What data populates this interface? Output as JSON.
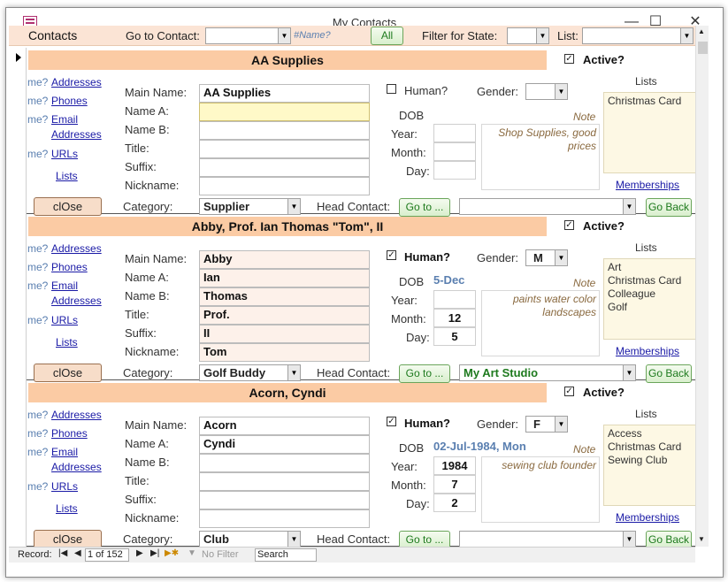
{
  "window": {
    "title": "My Contacts",
    "minimize_glyph": "—",
    "maximize_glyph": "☐",
    "close_glyph": "✕"
  },
  "header": {
    "title": "Contacts",
    "goto_label": "Go to Contact:",
    "goto_value": "",
    "name_hint": "#Name?",
    "all_label": "All",
    "filter_label": "Filter for State:",
    "list_label": "List:"
  },
  "records": [
    {
      "title": "AA Supplies",
      "active_label": "Active?",
      "active": "✓",
      "human_label": "Human?",
      "human": "",
      "gender_label": "Gender:",
      "gender": "",
      "links": {
        "me1": "me?",
        "addresses": "Addresses",
        "me2": "me?",
        "phones": "Phones",
        "me3": "me?",
        "email": "Email",
        "email_addresses": "Addresses",
        "me4": "me?",
        "urls": "URLs",
        "lists": "Lists"
      },
      "labels": {
        "main": "Main Name:",
        "a": "Name A:",
        "b": "Name B:",
        "title": "Title:",
        "suffix": "Suffix:",
        "nickname": "Nickname:",
        "category": "Category:",
        "head": "Head Contact:",
        "dob": "DOB",
        "year": "Year:",
        "month": "Month:",
        "day": "Day:",
        "note": "Note",
        "lists": "Lists",
        "memberships": "Memberships"
      },
      "values": {
        "main": "AA Supplies",
        "a": "",
        "b": "",
        "title": "",
        "suffix": "",
        "nickname": "",
        "category": "Supplier",
        "head": "",
        "dob": "",
        "year": "",
        "month": "",
        "day": ""
      },
      "note": "Shop Supplies, good prices",
      "lists": [
        "Christmas Card"
      ],
      "close_label": "clOse",
      "goto_label": "Go to ...",
      "goback_label": "Go Back"
    },
    {
      "title": "Abby, Prof. Ian Thomas \"Tom\", II",
      "active_label": "Active?",
      "active": "✓",
      "human_label": "Human?",
      "human": "✓",
      "gender_label": "Gender:",
      "gender": "M",
      "links": {
        "me1": "me?",
        "addresses": "Addresses",
        "me2": "me?",
        "phones": "Phones",
        "me3": "me?",
        "email": "Email",
        "email_addresses": "Addresses",
        "me4": "me?",
        "urls": "URLs",
        "lists": "Lists"
      },
      "labels": {
        "main": "Main Name:",
        "a": "Name A:",
        "b": "Name B:",
        "title": "Title:",
        "suffix": "Suffix:",
        "nickname": "Nickname:",
        "category": "Category:",
        "head": "Head Contact:",
        "dob": "DOB",
        "year": "Year:",
        "month": "Month:",
        "day": "Day:",
        "note": "Note",
        "lists": "Lists",
        "memberships": "Memberships"
      },
      "values": {
        "main": "Abby",
        "a": "Ian",
        "b": "Thomas",
        "title": "Prof.",
        "suffix": "II",
        "nickname": "Tom",
        "category": "Golf Buddy",
        "head": "My Art Studio",
        "dob": "5-Dec",
        "year": "",
        "month": "12",
        "day": "5"
      },
      "note": "paints water color landscapes",
      "lists": [
        "Art",
        "Christmas Card",
        "Colleague",
        "Golf"
      ],
      "close_label": "clOse",
      "goto_label": "Go to ...",
      "goback_label": "Go Back"
    },
    {
      "title": "Acorn, Cyndi",
      "active_label": "Active?",
      "active": "✓",
      "human_label": "Human?",
      "human": "✓",
      "gender_label": "Gender:",
      "gender": "F",
      "links": {
        "me1": "me?",
        "addresses": "Addresses",
        "me2": "me?",
        "phones": "Phones",
        "me3": "me?",
        "email": "Email",
        "email_addresses": "Addresses",
        "me4": "me?",
        "urls": "URLs",
        "lists": "Lists"
      },
      "labels": {
        "main": "Main Name:",
        "a": "Name A:",
        "b": "Name B:",
        "title": "Title:",
        "suffix": "Suffix:",
        "nickname": "Nickname:",
        "category": "Category:",
        "head": "Head Contact:",
        "dob": "DOB",
        "year": "Year:",
        "month": "Month:",
        "day": "Day:",
        "note": "Note",
        "lists": "Lists",
        "memberships": "Memberships"
      },
      "values": {
        "main": "Acorn",
        "a": "Cyndi",
        "b": "",
        "title": "",
        "suffix": "",
        "nickname": "",
        "category": "Club",
        "head": "",
        "dob": "02-Jul-1984, Mon",
        "year": "1984",
        "month": "7",
        "day": "2"
      },
      "note": "sewing club founder",
      "lists": [
        "Access",
        "Christmas Card",
        "Sewing Club"
      ],
      "close_label": "clOse",
      "goto_label": "Go to ...",
      "goback_label": "Go Back"
    }
  ],
  "status": {
    "record_label": "Record:",
    "position": "1 of 152",
    "no_filter": "No Filter",
    "search": "Search"
  },
  "colors": {
    "header_bg": "#fbe4d5",
    "title_bg": "#fbcba4",
    "link": "#1a1aa6",
    "green": "#1e7a1e"
  }
}
